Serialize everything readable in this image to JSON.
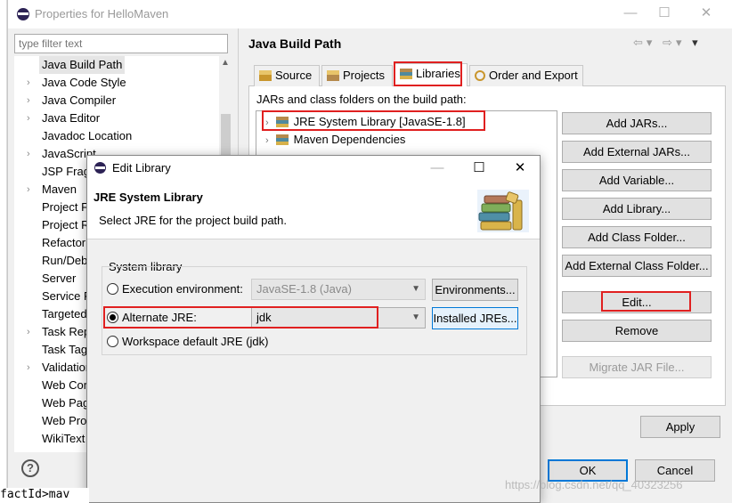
{
  "window": {
    "title": "Properties for HelloMaven",
    "minimize": "—",
    "maximize": "☐",
    "close": "✕"
  },
  "filter": {
    "placeholder": "type filter text"
  },
  "tree": {
    "items": [
      {
        "label": "Java Build Path",
        "expandable": false,
        "selected": true
      },
      {
        "label": "Java Code Style",
        "expandable": true
      },
      {
        "label": "Java Compiler",
        "expandable": true
      },
      {
        "label": "Java Editor",
        "expandable": true
      },
      {
        "label": "Javadoc Location",
        "expandable": false
      },
      {
        "label": "JavaScript",
        "expandable": true
      },
      {
        "label": "JSP Fragm",
        "expandable": false
      },
      {
        "label": "Maven",
        "expandable": true
      },
      {
        "label": "Project Fa",
        "expandable": false
      },
      {
        "label": "Project Re",
        "expandable": false
      },
      {
        "label": "Refactorin",
        "expandable": false
      },
      {
        "label": "Run/Debu",
        "expandable": false
      },
      {
        "label": "Server",
        "expandable": false
      },
      {
        "label": "Service Po",
        "expandable": false
      },
      {
        "label": "Targeted",
        "expandable": false
      },
      {
        "label": "Task Repo",
        "expandable": true
      },
      {
        "label": "Task Tags",
        "expandable": false
      },
      {
        "label": "Validation",
        "expandable": true
      },
      {
        "label": "Web Cont",
        "expandable": false
      },
      {
        "label": "Web Page",
        "expandable": false
      },
      {
        "label": "Web Proje",
        "expandable": false
      },
      {
        "label": "WikiText",
        "expandable": false
      }
    ]
  },
  "help": "?",
  "page": {
    "title": "Java Build Path",
    "tabs": [
      {
        "label": "Source",
        "icon": "source-folder-icon"
      },
      {
        "label": "Projects",
        "icon": "projects-icon"
      },
      {
        "label": "Libraries",
        "icon": "libraries-icon",
        "active": true
      },
      {
        "label": "Order and Export",
        "icon": "order-export-icon"
      }
    ],
    "panel_label": "JARs and class folders on the build path:",
    "libraries": [
      {
        "label": "JRE System Library [JavaSE-1.8]"
      },
      {
        "label": "Maven Dependencies"
      }
    ],
    "buttons": {
      "add_jars": "Add JARs...",
      "add_external_jars": "Add External JARs...",
      "add_variable": "Add Variable...",
      "add_library": "Add Library...",
      "add_class_folder": "Add Class Folder...",
      "add_external_class_folder": "Add External Class Folder...",
      "edit": "Edit...",
      "remove": "Remove",
      "migrate_jar": "Migrate JAR File..."
    },
    "apply": "Apply",
    "ok": "OK",
    "cancel": "Cancel"
  },
  "dialog": {
    "title": "Edit Library",
    "header_title": "JRE System Library",
    "header_desc": "Select JRE for the project build path.",
    "group_label": "System library",
    "options": {
      "execution_env": {
        "label": "Execution environment:",
        "value": "JavaSE-1.8 (Java)",
        "button": "Environments..."
      },
      "alternate_jre": {
        "label": "Alternate JRE:",
        "value": "jdk",
        "button": "Installed JREs...",
        "selected": true
      },
      "workspace_default": {
        "label": "Workspace default JRE (jdk)"
      }
    }
  },
  "editor": {
    "bottom_text": "factId>mav"
  },
  "watermark": "https://blog.csdn.net/qq_40323256"
}
